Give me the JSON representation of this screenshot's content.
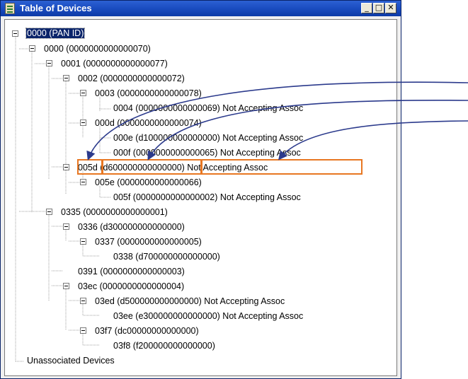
{
  "window": {
    "title": "Table of Devices",
    "minimize_glyph": "_",
    "maximize_glyph": "□",
    "close_glyph": "✕"
  },
  "tree": {
    "root": "0000 (PAN ID)",
    "nodes": [
      "0000 (0000000000000070)",
      "0001 (0000000000000077)",
      "0002 (0000000000000072)",
      "0003 (0000000000000078)",
      "0004 (0000000000000069) Not Accepting Assoc",
      "000d (0000000000000074)",
      "000e (d100000000000000) Not Accepting Assoc",
      "000f (0000000000000065) Not Accepting Assoc",
      "005d (d600000000000000) Not Accepting Assoc",
      "005e (0000000000000066)",
      "005f (0000000000000002) Not Accepting Assoc",
      "0335 (0000000000000001)",
      "0336 (d300000000000000)",
      "0337 (0000000000000005)",
      "0338 (d700000000000000)",
      "0391 (0000000000000003)",
      "03ec (0000000000000004)",
      "03ed (d500000000000000) Not Accepting Assoc",
      "03ee (e300000000000000) Not Accepting Assoc",
      "03f7 (dc00000000000000)",
      "03f8 (f200000000000000)"
    ],
    "unassociated": "Unassociated Devices"
  },
  "annotation": {
    "color": "#e87722",
    "arrow_color": "#2b3a8c"
  }
}
